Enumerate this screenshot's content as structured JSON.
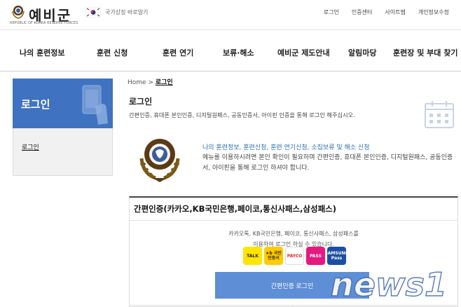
{
  "header": {
    "logo_text": "예비군",
    "logo_sub": "REPUBLIC OF KOREA RESERVE FORCES",
    "flag_text": "국가상징 바로알기",
    "util_links": [
      "로그인",
      "인증센터",
      "사이트맵",
      "개인정보수정"
    ]
  },
  "gnb": {
    "items": [
      "나의 훈련정보",
      "훈련 신청",
      "훈련 연기",
      "보류·해소",
      "예비군 제도안내",
      "알림마당",
      "훈련장 및 부대 찾기"
    ]
  },
  "lnb": {
    "title": "로그인",
    "links": [
      "로그인"
    ]
  },
  "breadcrumb": {
    "home": "Home",
    "sep": ">",
    "current": "로그인"
  },
  "page": {
    "title": "로그인",
    "desc": "간편인증, 휴대폰 본인인증, 디지털원패스, 공동인증서, 아이핀 인증을 통해 로그인 해주십시오."
  },
  "info": {
    "title": "나의 훈련정보, 훈련신청, 훈련 연기신청, 소집보류 및 해소 신청",
    "text": "메뉴를 이용하시려면 본인 확인이 필요하며 간편인증, 휴대폰 본인인증, 디지털원패스, 공동인증서, 아이핀을 통해 로그인 하셔야 합니다."
  },
  "card": {
    "title": "간편인증(카카오,KB국민은행,페이코,통신사패스,삼성패스)",
    "text_line1": "카카오톡, KB국민은행, 페이코, 통신사패스, 삼성패스를",
    "text_line2": "이용하여 로그인 하실 수 있습니다.",
    "certs": [
      {
        "label": "TALK",
        "bg": "#fee500",
        "fg": "#3a1d1d"
      },
      {
        "label": "★b 국민인증서",
        "bg": "#ffcc00",
        "fg": "#3a2a00"
      },
      {
        "label": "PAYCO",
        "bg": "#ffffff",
        "fg": "#e3272c"
      },
      {
        "label": "PASS",
        "bg": "#e6197f",
        "fg": "#ffffff"
      },
      {
        "label": "SAMSUNG Pass",
        "bg": "#1c4fa3",
        "fg": "#ffffff"
      }
    ],
    "button": "간편인증 로그인"
  },
  "watermark": "news1",
  "colors": {
    "accent": "#3f72c0",
    "button": "#5e8ed6",
    "link": "#2a6fae"
  }
}
